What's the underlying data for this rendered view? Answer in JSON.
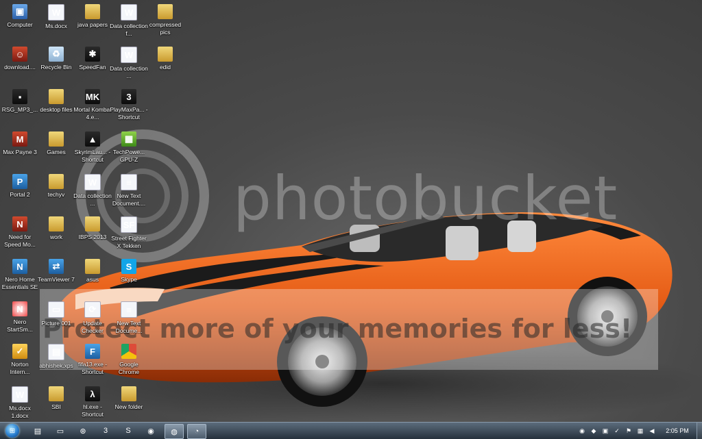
{
  "watermark": {
    "brand": "photobucket",
    "banner": "Protect more of your memories for less!"
  },
  "icons": [
    {
      "label": "Computer",
      "glyph": "▣",
      "cls": "g-computer",
      "col": 0,
      "row": 0
    },
    {
      "label": "Ms.docx",
      "glyph": "W",
      "cls": "g-word",
      "col": 1,
      "row": 0
    },
    {
      "label": "java papers",
      "glyph": "",
      "cls": "g-folder",
      "col": 2,
      "row": 0
    },
    {
      "label": "Data collection f...",
      "glyph": "W",
      "cls": "g-word",
      "col": 3,
      "row": 0
    },
    {
      "label": "compressed pics",
      "glyph": "",
      "cls": "g-folder",
      "col": 4,
      "row": 0
    },
    {
      "label": "download....",
      "glyph": "☺",
      "cls": "g-red",
      "col": 0,
      "row": 1
    },
    {
      "label": "Recycle Bin",
      "glyph": "♻",
      "cls": "g-recycle",
      "col": 1,
      "row": 1
    },
    {
      "label": "SpeedFan",
      "glyph": "✱",
      "cls": "g-game",
      "col": 2,
      "row": 1
    },
    {
      "label": "Data collection ...",
      "glyph": "W",
      "cls": "g-word",
      "col": 3,
      "row": 1
    },
    {
      "label": "edid",
      "glyph": "",
      "cls": "g-folder",
      "col": 4,
      "row": 1
    },
    {
      "label": "RSG_MP3_...",
      "glyph": "▪",
      "cls": "g-game",
      "col": 0,
      "row": 2
    },
    {
      "label": "desktop files",
      "glyph": "",
      "cls": "g-folder",
      "col": 1,
      "row": 2
    },
    {
      "label": "Mortal Kombat 4.e...",
      "glyph": "MK",
      "cls": "g-game",
      "col": 2,
      "row": 2
    },
    {
      "label": "PlayMaxPa... - Shortcut",
      "glyph": "3",
      "cls": "g-game",
      "col": 3,
      "row": 2
    },
    {
      "label": "Max Payne 3",
      "glyph": "M",
      "cls": "g-red",
      "col": 0,
      "row": 3
    },
    {
      "label": "Games",
      "glyph": "",
      "cls": "g-folder",
      "col": 1,
      "row": 3
    },
    {
      "label": "SkyrimLau... - Shortcut",
      "glyph": "▲",
      "cls": "g-game",
      "col": 2,
      "row": 3
    },
    {
      "label": "TechPowe... GPU-Z",
      "glyph": "▦",
      "cls": "g-green",
      "col": 3,
      "row": 3
    },
    {
      "label": "Portal 2",
      "glyph": "P",
      "cls": "g-blue",
      "col": 0,
      "row": 4
    },
    {
      "label": "techyv",
      "glyph": "",
      "cls": "g-folder",
      "col": 1,
      "row": 4
    },
    {
      "label": "Data collection ...",
      "glyph": "W",
      "cls": "g-word",
      "col": 2,
      "row": 4
    },
    {
      "label": "New Text Document....",
      "glyph": "≡",
      "cls": "g-doc",
      "col": 3,
      "row": 4
    },
    {
      "label": "Need for Speed Mo...",
      "glyph": "N",
      "cls": "g-red",
      "col": 0,
      "row": 5
    },
    {
      "label": "work",
      "glyph": "",
      "cls": "g-folder",
      "col": 1,
      "row": 5
    },
    {
      "label": "IBPS 2013",
      "glyph": "",
      "cls": "g-folder",
      "col": 2,
      "row": 5
    },
    {
      "label": "Street Fighter X Tekken",
      "glyph": "SF",
      "cls": "g-doc",
      "col": 3,
      "row": 5
    },
    {
      "label": "Nero Home Essentials SE",
      "glyph": "N",
      "cls": "g-blue",
      "col": 0,
      "row": 6
    },
    {
      "label": "TeamViewer 7",
      "glyph": "⇄",
      "cls": "g-blue",
      "col": 1,
      "row": 6
    },
    {
      "label": "asus",
      "glyph": "",
      "cls": "g-folder",
      "col": 2,
      "row": 6
    },
    {
      "label": "Skype",
      "glyph": "S",
      "cls": "g-skype",
      "col": 3,
      "row": 6
    },
    {
      "label": "Nero StartSm...",
      "glyph": "N",
      "cls": "g-nero",
      "col": 0,
      "row": 7
    },
    {
      "label": "Picture 001",
      "glyph": "▭",
      "cls": "g-doc",
      "col": 1,
      "row": 7
    },
    {
      "label": "Update Checker",
      "glyph": "⟳",
      "cls": "g-doc",
      "col": 2,
      "row": 7
    },
    {
      "label": "New Text Docume...",
      "glyph": "≡",
      "cls": "g-doc",
      "col": 3,
      "row": 7
    },
    {
      "label": "Norton Intern...",
      "glyph": "✓",
      "cls": "g-norton",
      "col": 0,
      "row": 8
    },
    {
      "label": "abhishek.xps",
      "glyph": "▤",
      "cls": "g-doc",
      "col": 1,
      "row": 8
    },
    {
      "label": "fifa13.exe - Shortcut",
      "glyph": "F",
      "cls": "g-blue",
      "col": 2,
      "row": 8
    },
    {
      "label": "Google Chrome",
      "glyph": "",
      "cls": "g-chrome",
      "col": 3,
      "row": 8
    },
    {
      "label": "Ms.docx 1.docx",
      "glyph": "W",
      "cls": "g-word",
      "col": 0,
      "row": 9
    },
    {
      "label": "SBI",
      "glyph": "",
      "cls": "g-folder",
      "col": 1,
      "row": 9
    },
    {
      "label": "hl.exe - Shortcut",
      "glyph": "λ",
      "cls": "g-game",
      "col": 2,
      "row": 9
    },
    {
      "label": "New folder",
      "glyph": "",
      "cls": "g-folder",
      "col": 3,
      "row": 9
    }
  ],
  "taskbar": {
    "pinned": [
      {
        "name": "taskbar-explorer",
        "glyph": "▤",
        "active": false
      },
      {
        "name": "taskbar-teamviewer",
        "glyph": "▭",
        "active": false
      },
      {
        "name": "taskbar-steam",
        "glyph": "⊛",
        "active": false
      },
      {
        "name": "taskbar-game",
        "glyph": "3",
        "active": false
      },
      {
        "name": "taskbar-skype",
        "glyph": "S",
        "active": false
      },
      {
        "name": "taskbar-chrome",
        "glyph": "◉",
        "active": false
      },
      {
        "name": "taskbar-firefox",
        "glyph": "◍",
        "active": true
      },
      {
        "name": "taskbar-paint",
        "glyph": "◔",
        "active": true
      }
    ],
    "tray": [
      {
        "name": "tray-globe",
        "glyph": "◉"
      },
      {
        "name": "tray-nvidia",
        "glyph": "◆"
      },
      {
        "name": "tray-speedfan",
        "glyph": "▣"
      },
      {
        "name": "tray-norton",
        "glyph": "✓"
      },
      {
        "name": "tray-flag",
        "glyph": "⚑"
      },
      {
        "name": "tray-network",
        "glyph": "▦"
      },
      {
        "name": "tray-volume",
        "glyph": "◀"
      }
    ],
    "clock": "2:05 PM"
  }
}
